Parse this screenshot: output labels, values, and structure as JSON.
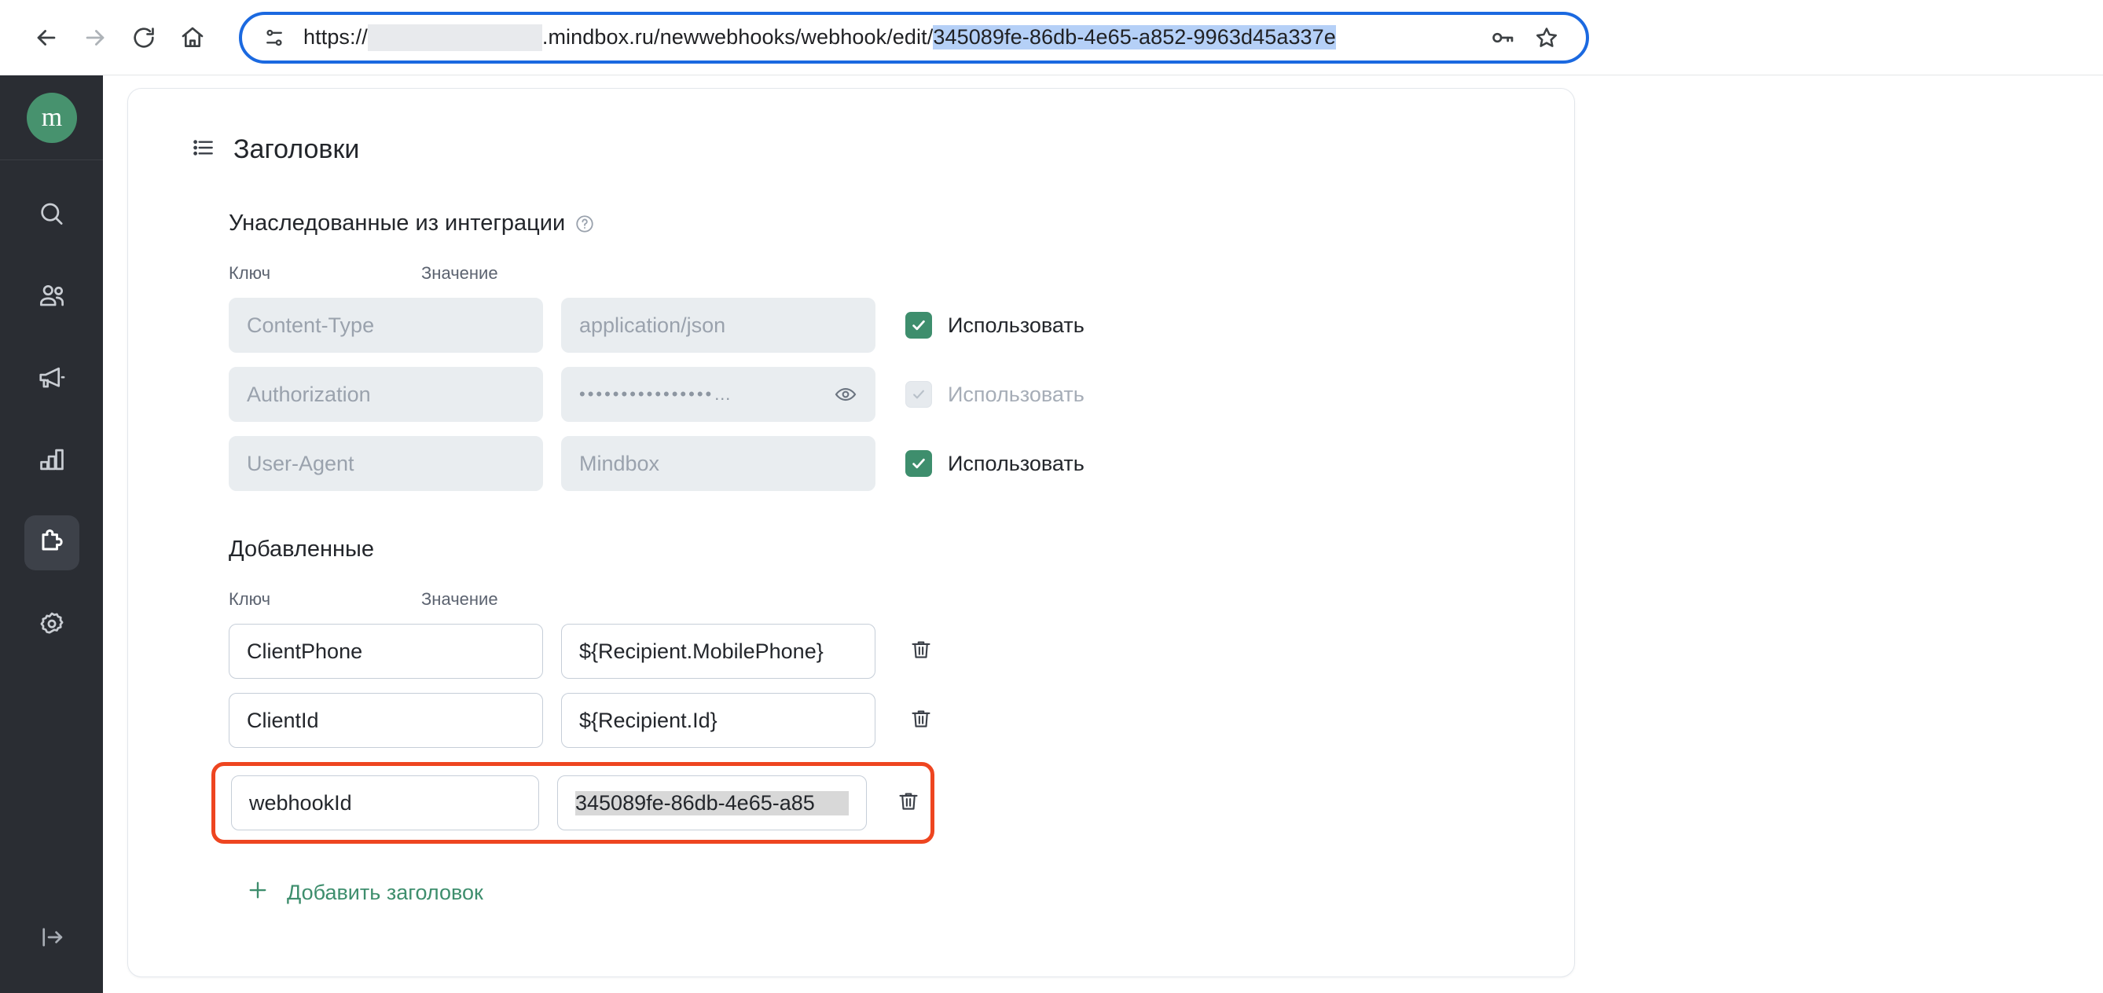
{
  "browser": {
    "back_icon": "arrow-left-icon",
    "forward_icon": "arrow-right-icon",
    "reload_icon": "reload-icon",
    "home_icon": "home-icon",
    "site_info_icon": "site-settings-icon",
    "url_scheme": "https://",
    "url_redacted": "",
    "url_domain": ".mindbox.ru/newwebhooks/webhook/edit/",
    "url_selected": "345089fe-86db-4e65-a852-9963d45a337e",
    "password_key_icon": "key-icon",
    "bookmark_icon": "star-icon"
  },
  "sidebar": {
    "logo_text": "m",
    "logo_color": "#47926e",
    "items": [
      {
        "name": "search",
        "icon": "search-icon",
        "active": false
      },
      {
        "name": "customers",
        "icon": "people-icon",
        "active": false
      },
      {
        "name": "campaigns",
        "icon": "megaphone-icon",
        "active": false
      },
      {
        "name": "analytics",
        "icon": "bar-chart-icon",
        "active": false
      },
      {
        "name": "integrations",
        "icon": "puzzle-icon",
        "active": true
      },
      {
        "name": "settings",
        "icon": "gear-icon",
        "active": false
      }
    ],
    "bottom_item": {
      "name": "logout",
      "icon": "logout-icon"
    }
  },
  "card": {
    "title": "Заголовки",
    "title_icon": "list-icon",
    "inherited": {
      "section_title": "Унаследованные из интеграции",
      "help_icon": "question-circle-icon",
      "col_key": "Ключ",
      "col_value": "Значение",
      "rows": [
        {
          "key": "Content-Type",
          "value": "application/json",
          "masked": false,
          "use_label": "Использовать",
          "checked": true,
          "disabled": false
        },
        {
          "key": "Authorization",
          "value": "••••••••••••••••…",
          "masked": true,
          "eye_icon": "eye-icon",
          "use_label": "Использовать",
          "checked": true,
          "disabled": true
        },
        {
          "key": "User-Agent",
          "value": "Mindbox",
          "masked": false,
          "use_label": "Использовать",
          "checked": true,
          "disabled": false
        }
      ]
    },
    "added": {
      "section_title": "Добавленные",
      "col_key": "Ключ",
      "col_value": "Значение",
      "delete_icon": "trash-icon",
      "rows": [
        {
          "key": "ClientPhone",
          "value": "${Recipient.MobilePhone}",
          "highlighted": false,
          "value_selected": false
        },
        {
          "key": "ClientId",
          "value": "${Recipient.Id}",
          "highlighted": false,
          "value_selected": false
        },
        {
          "key": "webhookId",
          "value": "345089fe-86db-4e65-a85",
          "highlighted": true,
          "value_selected": true
        }
      ],
      "highlight_color": "#ee4520"
    },
    "add_button": {
      "label": "Добавить заголовок",
      "icon": "plus-icon",
      "color": "#3e8e6d"
    }
  }
}
